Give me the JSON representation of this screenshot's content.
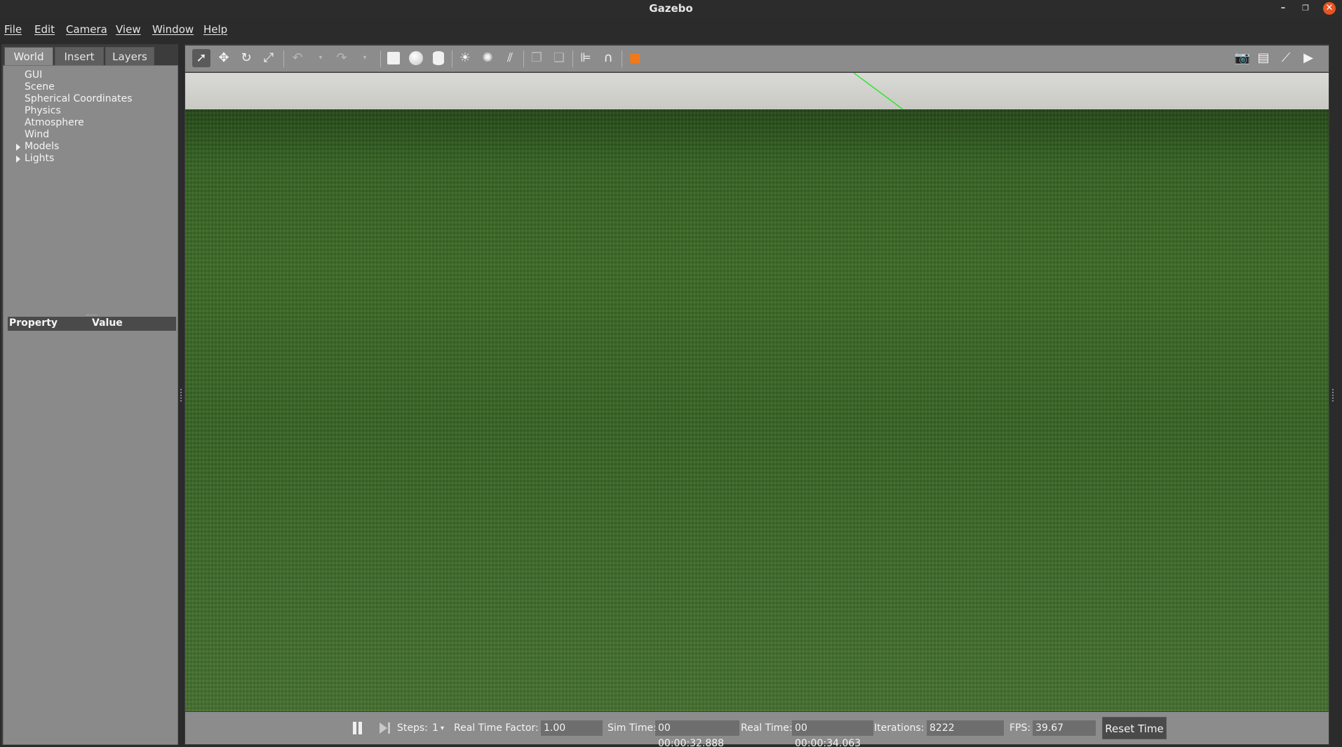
{
  "window": {
    "title": "Gazebo",
    "minimize": "–",
    "maximize": "❐",
    "close": "✕"
  },
  "menu": [
    "File",
    "Edit",
    "Camera",
    "View",
    "Window",
    "Help"
  ],
  "left_panel": {
    "tabs": [
      "World",
      "Insert",
      "Layers"
    ],
    "active_tab": "World",
    "tree": [
      {
        "label": "GUI",
        "expandable": false
      },
      {
        "label": "Scene",
        "expandable": false
      },
      {
        "label": "Spherical Coordinates",
        "expandable": false
      },
      {
        "label": "Physics",
        "expandable": false
      },
      {
        "label": "Atmosphere",
        "expandable": false
      },
      {
        "label": "Wind",
        "expandable": false
      },
      {
        "label": "Models",
        "expandable": true
      },
      {
        "label": "Lights",
        "expandable": true
      }
    ],
    "property_header": {
      "property": "Property",
      "value": "Value"
    }
  },
  "toolbar": {
    "icons": [
      "select-mode-icon",
      "translate-mode-icon",
      "rotate-mode-icon",
      "scale-mode-icon",
      "undo-icon",
      "undo-history-icon",
      "redo-icon",
      "redo-history-icon",
      "box-shape-icon",
      "sphere-shape-icon",
      "cylinder-shape-icon",
      "point-light-icon",
      "spot-light-icon",
      "directional-light-icon",
      "copy-icon",
      "paste-icon",
      "align-icon",
      "snap-icon",
      "view-angle-icon",
      "screenshot-icon",
      "log-icon",
      "plot-icon",
      "video-record-icon"
    ]
  },
  "viewport": {
    "sky_color": "#d4d4d0",
    "ground_color": "#3a6626",
    "axis_color": "#2ee62e"
  },
  "bottom_bar": {
    "steps_label": "Steps:",
    "steps_value": "1",
    "rtf_label": "Real Time Factor:",
    "rtf_value": "1.00",
    "sim_time_label": "Sim Time:",
    "sim_time_value": "00 00:00:32.888",
    "real_time_label": "Real Time:",
    "real_time_value": "00 00:00:34.063",
    "iterations_label": "Iterations:",
    "iterations_value": "8222",
    "fps_label": "FPS:",
    "fps_value": "39.67",
    "reset_label": "Reset Time"
  }
}
